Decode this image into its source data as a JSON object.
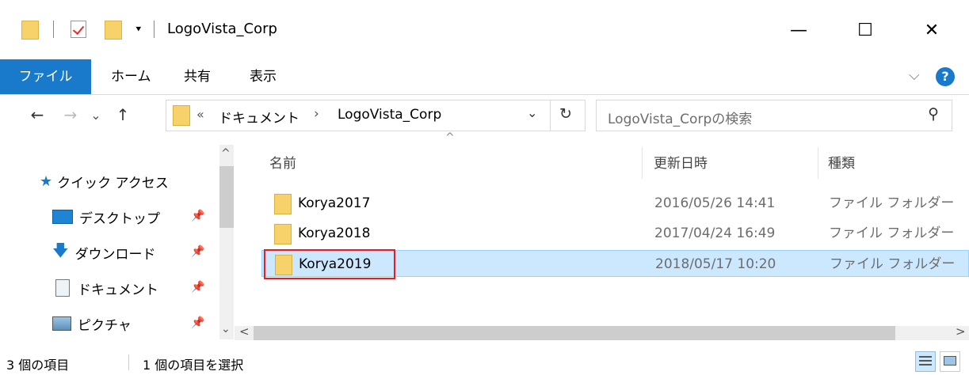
{
  "window": {
    "title": "LogoVista_Corp",
    "controls": {
      "minimize": "—",
      "maximize": "☐",
      "close": "✕"
    }
  },
  "quick_toolbar": {
    "dropdown": "⯆"
  },
  "ribbon": {
    "tabs": [
      {
        "label": "ファイル"
      },
      {
        "label": "ホーム"
      },
      {
        "label": "共有"
      },
      {
        "label": "表示"
      }
    ],
    "expand": "⌵",
    "help": "?"
  },
  "nav": {
    "back": "←",
    "forward": "→",
    "recent": "⌄",
    "up": "↑"
  },
  "address": {
    "overflow": "«",
    "crumbs": [
      "ドキュメント",
      "LogoVista_Corp"
    ],
    "separator": "›",
    "dropdown": "⌄",
    "refresh": "↻"
  },
  "search": {
    "placeholder": "LogoVista_Corpの検索",
    "icon": "⚲"
  },
  "navpane": {
    "items": [
      {
        "label": "クイック アクセス",
        "icon": "star-icon"
      },
      {
        "label": "デスクトップ",
        "icon": "desktop-icon",
        "pinned": true
      },
      {
        "label": "ダウンロード",
        "icon": "download-icon",
        "pinned": true
      },
      {
        "label": "ドキュメント",
        "icon": "documents-icon",
        "pinned": true
      },
      {
        "label": "ピクチャ",
        "icon": "pictures-icon",
        "pinned": true
      }
    ]
  },
  "list": {
    "columns": {
      "name": "名前",
      "date": "更新日時",
      "type": "種類"
    },
    "sort_indicator": "^",
    "rows": [
      {
        "name": "Korya2017",
        "date": "2016/05/26 14:41",
        "type": "ファイル フォルダー",
        "selected": false
      },
      {
        "name": "Korya2018",
        "date": "2017/04/24 16:49",
        "type": "ファイル フォルダー",
        "selected": false
      },
      {
        "name": "Korya2019",
        "date": "2018/05/17 10:20",
        "type": "ファイル フォルダー",
        "selected": true
      }
    ]
  },
  "scroll": {
    "up": "^",
    "down": "⌄",
    "left": "<",
    "right": ">"
  },
  "status": {
    "item_count": "3 個の項目",
    "selected_count": "1 個の項目を選択"
  },
  "colors": {
    "accent": "#1979ca",
    "selection": "#cce8ff",
    "highlight": "#e81c26",
    "folder": "#f7d26b"
  }
}
